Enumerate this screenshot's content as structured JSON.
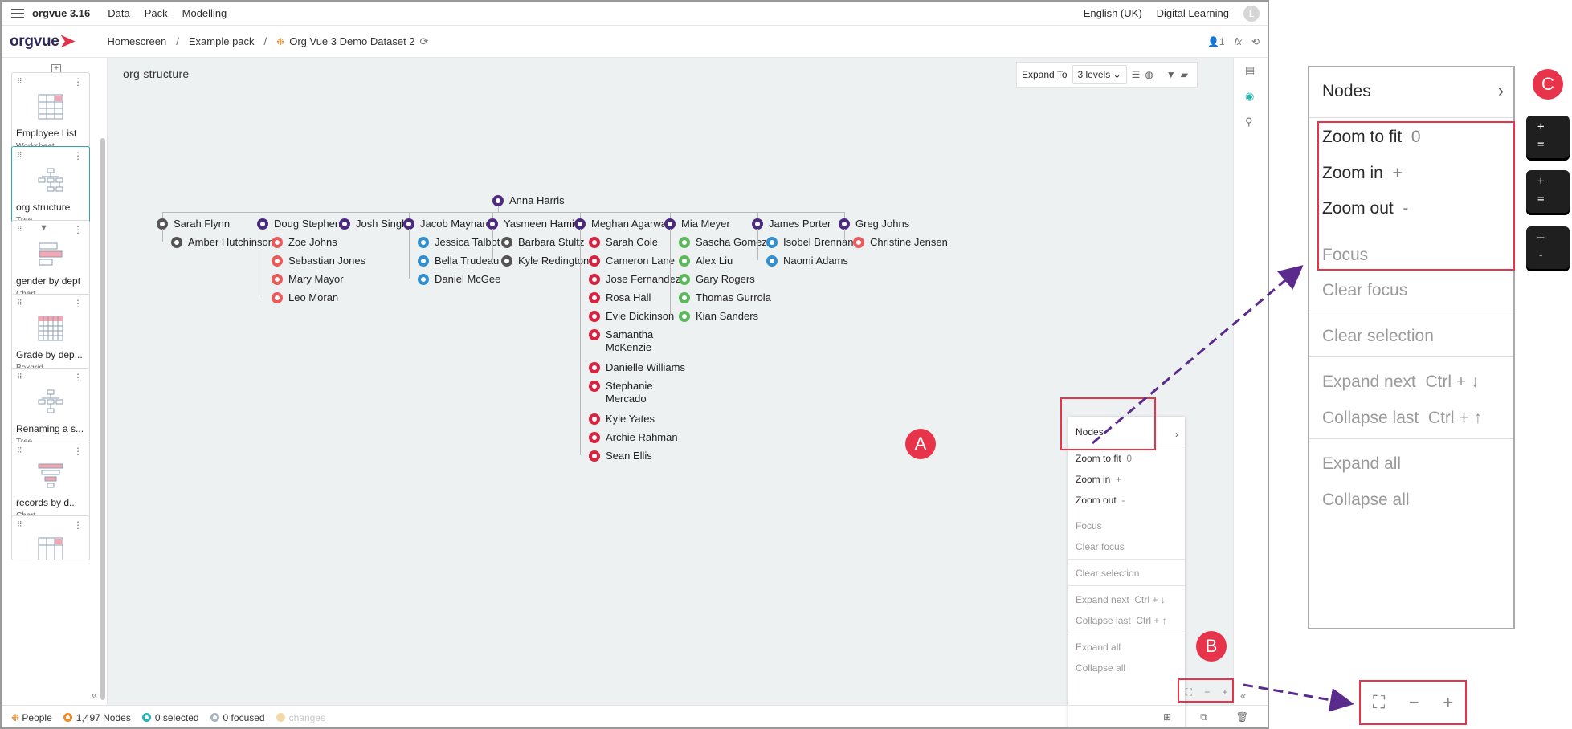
{
  "app": {
    "name": "orgvue 3.16",
    "menus": [
      "Data",
      "Pack",
      "Modelling"
    ],
    "language": "English (UK)",
    "workspace": "Digital Learning",
    "user_initial": "L"
  },
  "breadcrumb": {
    "logo": "orgvue",
    "home": "Homescreen",
    "pack": "Example pack",
    "dataset": "Org Vue 3 Demo Dataset 2",
    "users_count": "1",
    "fx_label": "fx"
  },
  "panels": [
    {
      "title": "Employee List",
      "type": "Worksheet"
    },
    {
      "title": "org structure",
      "type": "Tree"
    },
    {
      "title": "gender by dept",
      "type": "Chart"
    },
    {
      "title": "Grade by dep...",
      "type": "Boxgrid"
    },
    {
      "title": "Renaming a s...",
      "type": "Tree"
    },
    {
      "title": "records by d...",
      "type": "Chart"
    }
  ],
  "view": {
    "title": "org structure",
    "expand_label": "Expand To",
    "expand_value": "3 levels"
  },
  "colors": {
    "purple": "#4b2a7f",
    "gray": "#555555",
    "red": "#d8223f",
    "salmon": "#ec5a5a",
    "blue": "#2f8fd0",
    "green": "#5cb85c",
    "accent": "#e8344a",
    "teal": "#27b3b3"
  },
  "tree": {
    "root": "Anna Harris",
    "managers": [
      {
        "name": "Sarah Flynn",
        "reports": [
          "Amber Hutchinson"
        ]
      },
      {
        "name": "Doug Stephens",
        "reports": [
          "Zoe Johns",
          "Sebastian Jones",
          "Mary Mayor",
          "Leo Moran"
        ]
      },
      {
        "name": "Josh Singh",
        "reports": []
      },
      {
        "name": "Jacob Maynard",
        "reports": [
          "Jessica Talbot",
          "Bella Trudeau",
          "Daniel McGee"
        ]
      },
      {
        "name": "Yasmeen Hamidi",
        "reports": [
          "Barbara Stultz",
          "Kyle Redington"
        ]
      },
      {
        "name": "Meghan Agarwal",
        "reports": [
          "Sarah Cole",
          "Cameron Lane",
          "Jose Fernandez",
          "Rosa Hall",
          "Evie Dickinson",
          "Samantha McKenzie",
          "Danielle Williams",
          "Stephanie Mercado",
          "Kyle Yates",
          "Archie Rahman",
          "Sean Ellis"
        ]
      },
      {
        "name": "Mia Meyer",
        "reports": [
          "Sascha Gomez",
          "Alex Liu",
          "Gary Rogers",
          "Thomas Gurrola",
          "Kian Sanders"
        ]
      },
      {
        "name": "James Porter",
        "reports": [
          "Isobel Brennan",
          "Naomi Adams"
        ]
      },
      {
        "name": "Greg Johns",
        "reports": [
          "Christine Jensen"
        ]
      }
    ]
  },
  "context_menu": {
    "nodes": "Nodes",
    "zoom_fit": "Zoom to fit",
    "zoom_fit_key": "0",
    "zoom_in": "Zoom in",
    "zoom_in_key": "+",
    "zoom_out": "Zoom out",
    "zoom_out_key": "-",
    "focus": "Focus",
    "clear_focus": "Clear focus",
    "clear_selection": "Clear selection",
    "expand_next": "Expand next",
    "expand_next_key": "Ctrl + ↓",
    "collapse_last": "Collapse last",
    "collapse_last_key": "Ctrl + ↑",
    "expand_all": "Expand all",
    "collapse_all": "Collapse all"
  },
  "status": {
    "dataset": "People",
    "nodes": "1,497 Nodes",
    "selected": "0 selected",
    "focused": "0 focused",
    "changes": "changes"
  },
  "annotations": {
    "a": "A",
    "b": "B",
    "c": "C"
  },
  "keys": [
    {
      "top": "+",
      "bottom": "="
    },
    {
      "top": "+",
      "bottom": "="
    },
    {
      "top": "—",
      "bottom": "-"
    }
  ]
}
